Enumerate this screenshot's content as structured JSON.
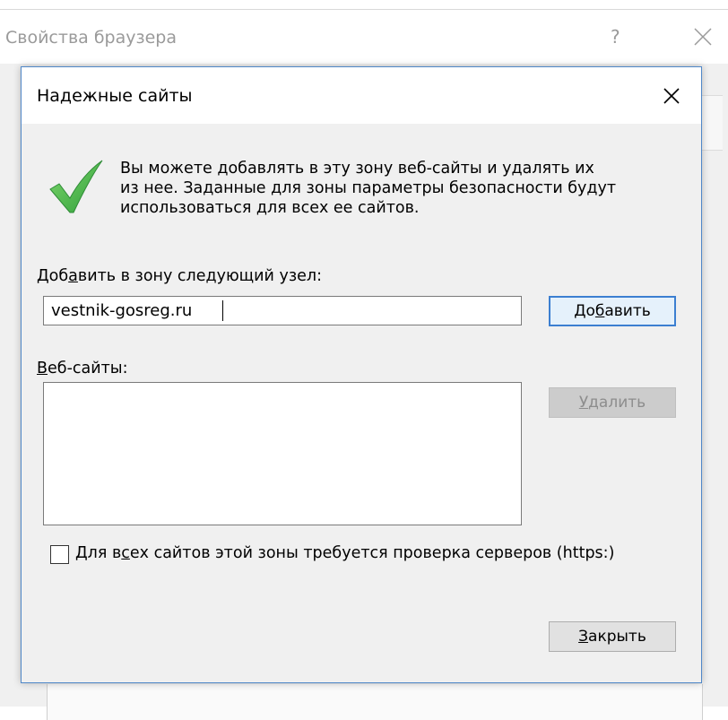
{
  "outer_window": {
    "title": "Свойства браузера",
    "help_label": "?"
  },
  "dialog": {
    "title": "Надежные сайты",
    "info_text_line1": "Вы можете добавлять в эту зону  веб-сайты и удалять их",
    "info_text_line2": "из нее. Заданные для зоны параметры безопасности будут",
    "info_text_line3": "использоваться для всех ее сайтов.",
    "add_label_part1": "Доб",
    "add_label_mnemonic": "а",
    "add_label_part2": "вить в зону следующий узел:",
    "site_input_value": "vestnik-gosreg.ru",
    "add_button_part1": "До",
    "add_button_mnemonic": "б",
    "add_button_part2": "авить",
    "websites_label_mnemonic": "В",
    "websites_label_rest": "еб-сайты:",
    "websites": [],
    "remove_button_mnemonic": "У",
    "remove_button_rest": "далить",
    "https_checkbox_checked": false,
    "https_label_part1": "Для в",
    "https_label_mnemonic": "с",
    "https_label_part2": "ех сайтов этой зоны требуется проверка серверов (https:)",
    "close_button_mnemonic": "З",
    "close_button_rest": "акрыть"
  },
  "colors": {
    "dialog_border": "#4f87c8",
    "default_button_border": "#3c7fd1",
    "checkmark_green": "#3fb23f"
  },
  "icons": {
    "check": "green-checkmark-icon",
    "close": "close-x-icon"
  }
}
